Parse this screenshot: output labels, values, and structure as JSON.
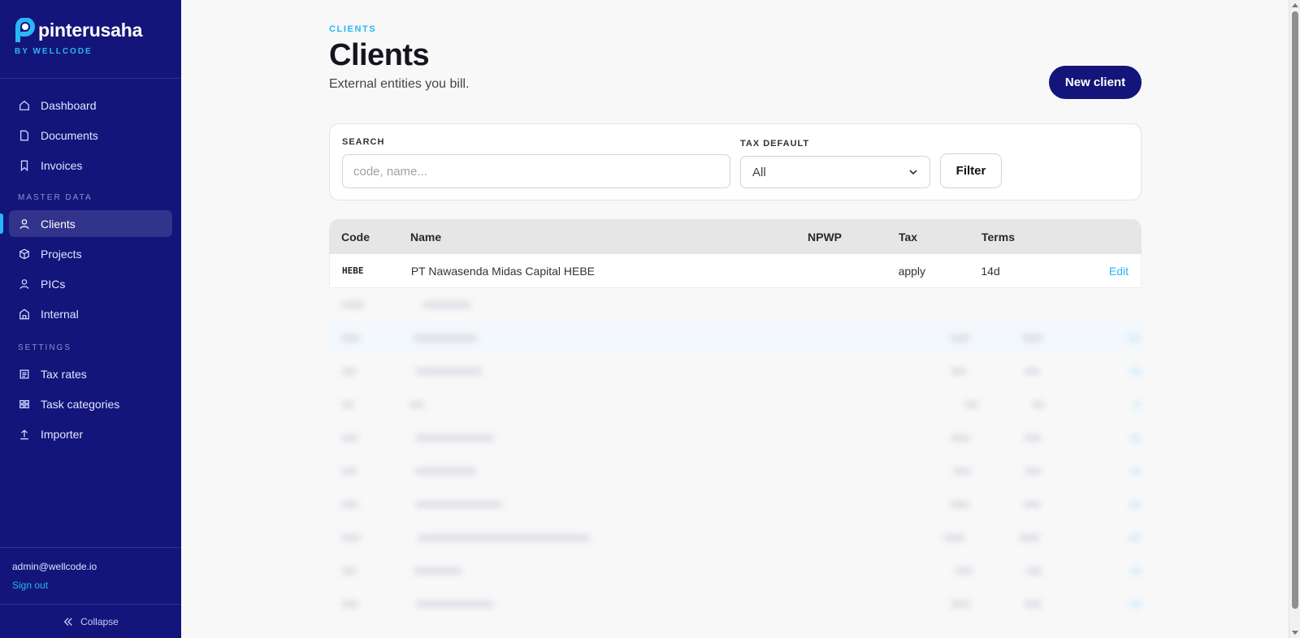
{
  "brand": {
    "name": "pinterusaha",
    "sub": "BY WELLCODE"
  },
  "sidebar": {
    "primary": [
      {
        "label": "Dashboard",
        "icon": "home-icon"
      },
      {
        "label": "Documents",
        "icon": "document-icon"
      },
      {
        "label": "Invoices",
        "icon": "bookmark-icon"
      }
    ],
    "master_section": "MASTER DATA",
    "master": [
      {
        "label": "Clients",
        "icon": "user-icon",
        "active": true
      },
      {
        "label": "Projects",
        "icon": "box-icon"
      },
      {
        "label": "PICs",
        "icon": "user-icon"
      },
      {
        "label": "Internal",
        "icon": "building-icon"
      }
    ],
    "settings_section": "SETTINGS",
    "settings": [
      {
        "label": "Tax rates",
        "icon": "receipt-icon"
      },
      {
        "label": "Task categories",
        "icon": "grid-icon"
      },
      {
        "label": "Importer",
        "icon": "upload-icon"
      }
    ],
    "user_email": "admin@wellcode.io",
    "sign_out": "Sign out",
    "collapse": "Collapse"
  },
  "header": {
    "eyebrow": "CLIENTS",
    "title": "Clients",
    "subtitle": "External entities you bill.",
    "new_button": "New client"
  },
  "filters": {
    "search_label": "SEARCH",
    "search_placeholder": "code, name...",
    "search_value": "",
    "tax_label": "TAX DEFAULT",
    "tax_value": "All",
    "filter_button": "Filter"
  },
  "table": {
    "columns": [
      "Code",
      "Name",
      "NPWP",
      "Tax",
      "Terms"
    ],
    "rows": [
      {
        "code": "HEBE",
        "name": "PT Nawasenda Midas Capital HEBE",
        "npwp": "",
        "tax": "apply",
        "terms": "14d",
        "action": "Edit"
      }
    ]
  },
  "colors": {
    "sidebar": "#14157a",
    "accent": "#29b6f6",
    "primary_button": "#14157a"
  }
}
